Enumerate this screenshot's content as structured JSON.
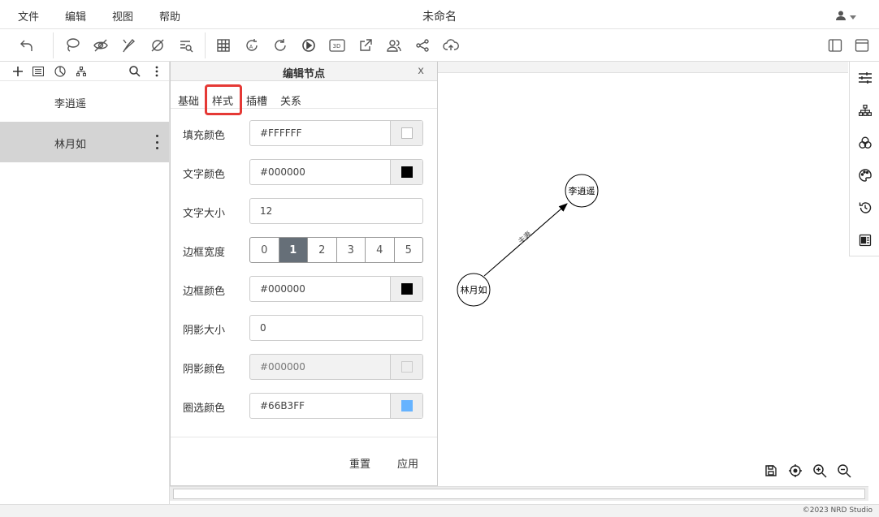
{
  "menubar": {
    "menus": [
      "文件",
      "编辑",
      "视图",
      "帮助"
    ],
    "title": "未命名"
  },
  "toolbar": {
    "icons": [
      "undo-icon",
      "lasso-icon",
      "hide-icon",
      "brush-icon",
      "no-entry-icon",
      "find-icon",
      "table-icon",
      "auto-layout-icon",
      "refresh-icon",
      "play-icon",
      "3d-icon",
      "export-icon",
      "users-icon",
      "share-icon",
      "upload-icon",
      "panel-left-icon",
      "panel-window-icon"
    ],
    "btn_3d": "3D"
  },
  "left_panel": {
    "items": [
      {
        "label": "李逍遥",
        "active": false
      },
      {
        "label": "林月如",
        "active": true
      }
    ]
  },
  "dialog": {
    "title": "编辑节点",
    "close": "x",
    "tabs": [
      "基础",
      "样式",
      "插槽",
      "关系"
    ],
    "active_tab": "样式",
    "fields": {
      "fill_color": {
        "label": "填充颜色",
        "value": "#FFFFFF",
        "swatch": "#FFFFFF"
      },
      "text_color": {
        "label": "文字颜色",
        "value": "#000000",
        "swatch": "#000000"
      },
      "text_size": {
        "label": "文字大小",
        "value": "12"
      },
      "border_width": {
        "label": "边框宽度",
        "options": [
          "0",
          "1",
          "2",
          "3",
          "4",
          "5"
        ],
        "selected": "1"
      },
      "border_color": {
        "label": "边框颜色",
        "value": "#000000",
        "swatch": "#000000"
      },
      "shadow_size": {
        "label": "阴影大小",
        "value": "0"
      },
      "shadow_color": {
        "label": "阴影颜色",
        "value": "#000000",
        "swatch": "#EEEEEE"
      },
      "select_color": {
        "label": "圈选颜色",
        "value": "#66B3FF",
        "swatch": "#66B3FF"
      }
    },
    "reset": "重置",
    "apply": "应用"
  },
  "graph": {
    "nodes": [
      {
        "label": "李逍遥"
      },
      {
        "label": "林月如"
      }
    ],
    "edge_label": "夫妻"
  },
  "status": {
    "copyright": "©2023 NRD Studio"
  },
  "colors": {
    "accent_tab_highlight": "#E53935",
    "seg_active": "#666F78",
    "list_active": "#D4D4D4"
  }
}
